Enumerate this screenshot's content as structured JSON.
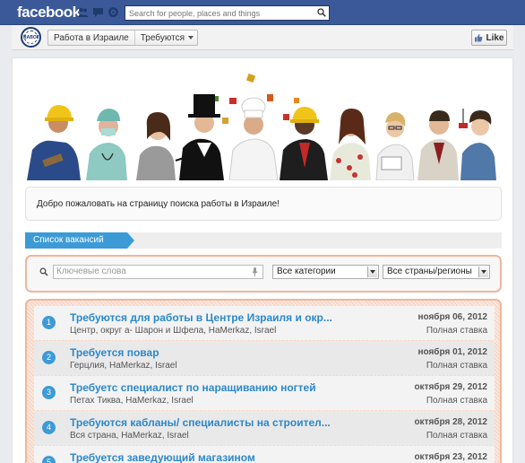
{
  "topbar": {
    "logo": "facebook",
    "search_placeholder": "Search for people, places and things",
    "icons": [
      "friends-icon",
      "messages-icon",
      "notifications-icon",
      "search-icon"
    ]
  },
  "page_header": {
    "avatar_text": "RABOTA",
    "page_name": "Работа в Израиле",
    "tab": "Требуются",
    "like": "Like"
  },
  "banner": {
    "people": [
      "worker-hardhat",
      "nurse",
      "woman-gray",
      "magician",
      "chef",
      "businessman-hardhat",
      "woman-dress",
      "woman-glasses",
      "man-suit",
      "woman-drill"
    ]
  },
  "welcome_text": "Добро пожаловать на страницу поиска работы в Израиле!",
  "section_tab": "Список вакансий",
  "filters": {
    "keyword_placeholder": "Ключевые слова",
    "category": "Все категории",
    "region": "Все страны/регионы"
  },
  "jobs": [
    {
      "n": "1",
      "title": "Требуются для работы в Центре Израиля и окр...",
      "location": "Центр, округ а- Шарон и Шфела, HaMerkaz, Israel",
      "date": "ноября 06, 2012",
      "type": "Полная ставка"
    },
    {
      "n": "2",
      "title": "Требуется повар",
      "location": "Герцлия, HaMerkaz, Israel",
      "date": "ноября 01, 2012",
      "type": "Полная ставка"
    },
    {
      "n": "3",
      "title": "Требуетс специалист по наращиванию ногтей",
      "location": "Петах Тиква, HaMerkaz, Israel",
      "date": "октября 29, 2012",
      "type": "Полная ставка"
    },
    {
      "n": "4",
      "title": "Требуются кабланы/ специалисты на строител...",
      "location": "Вся страна, HaMerkaz, Israel",
      "date": "октября 28, 2012",
      "type": "Полная ставка"
    },
    {
      "n": "5",
      "title": "Требуется заведующий магазином",
      "location": "",
      "date": "октября 23, 2012",
      "type": ""
    }
  ]
}
